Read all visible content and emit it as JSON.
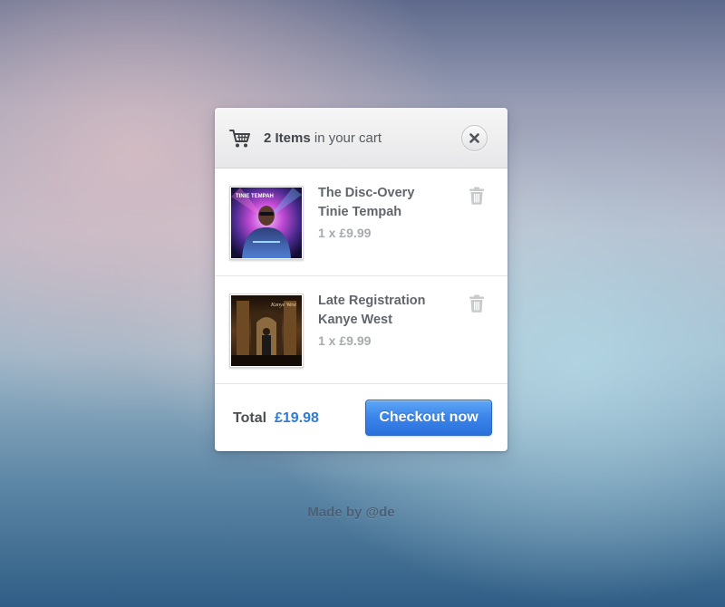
{
  "cart": {
    "count_text": "2 Items",
    "title_suffix": " in your cart",
    "cart_icon": "shopping-cart-icon",
    "close_icon": "close-icon",
    "items": [
      {
        "title": "The Disc-Overy",
        "artist": "Tinie Tempah",
        "quantity_price": "1 x £9.99",
        "album_art": "album-cover-tinie-tempah",
        "delete_icon": "trash-icon",
        "cover_text": "TINIE TEMPAH"
      },
      {
        "title": "Late Registration",
        "artist": "Kanye West",
        "quantity_price": "1 x £9.99",
        "album_art": "album-cover-kanye-west",
        "delete_icon": "trash-icon",
        "cover_text": "Kanye West"
      }
    ],
    "total_label": "Total",
    "total_value": "£19.98",
    "checkout_label": "Checkout now"
  },
  "credit": "Made by @de",
  "colors": {
    "accent": "#2f7bd6",
    "button_top": "#5fa7f6",
    "button_bottom": "#2b71dc",
    "text_dark": "#4a4f54",
    "text_muted": "#a8abae"
  }
}
